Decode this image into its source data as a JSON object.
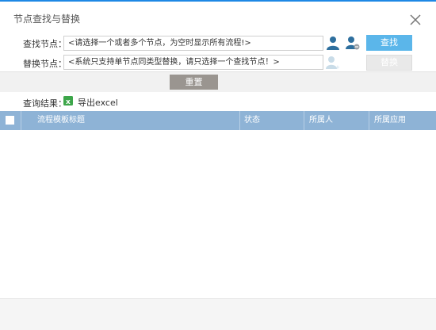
{
  "dialog": {
    "title": "节点查找与替换"
  },
  "find": {
    "label": "查找节点：",
    "value": "<请选择一个或者多个节点，为空时显示所有流程!>",
    "button": "查找"
  },
  "replace": {
    "label": "替换节点：",
    "value": "<系统只支持单节点同类型替换，请只选择一个查找节点！>",
    "button": "替换"
  },
  "reset_button": "重置",
  "results": {
    "label": "查询结果：",
    "export_label": "导出excel"
  },
  "table": {
    "columns": [
      "流程模板标题",
      "状态",
      "所属人",
      "所属应用"
    ],
    "rows": []
  },
  "colors": {
    "accent": "#5bb6ea",
    "table_header": "#8eb3d6",
    "reset_button": "#9a9590",
    "excel": "#3da64a"
  },
  "icons": [
    "close-icon",
    "select-person-icon",
    "clear-person-icon",
    "add-person-icon",
    "excel-icon"
  ]
}
